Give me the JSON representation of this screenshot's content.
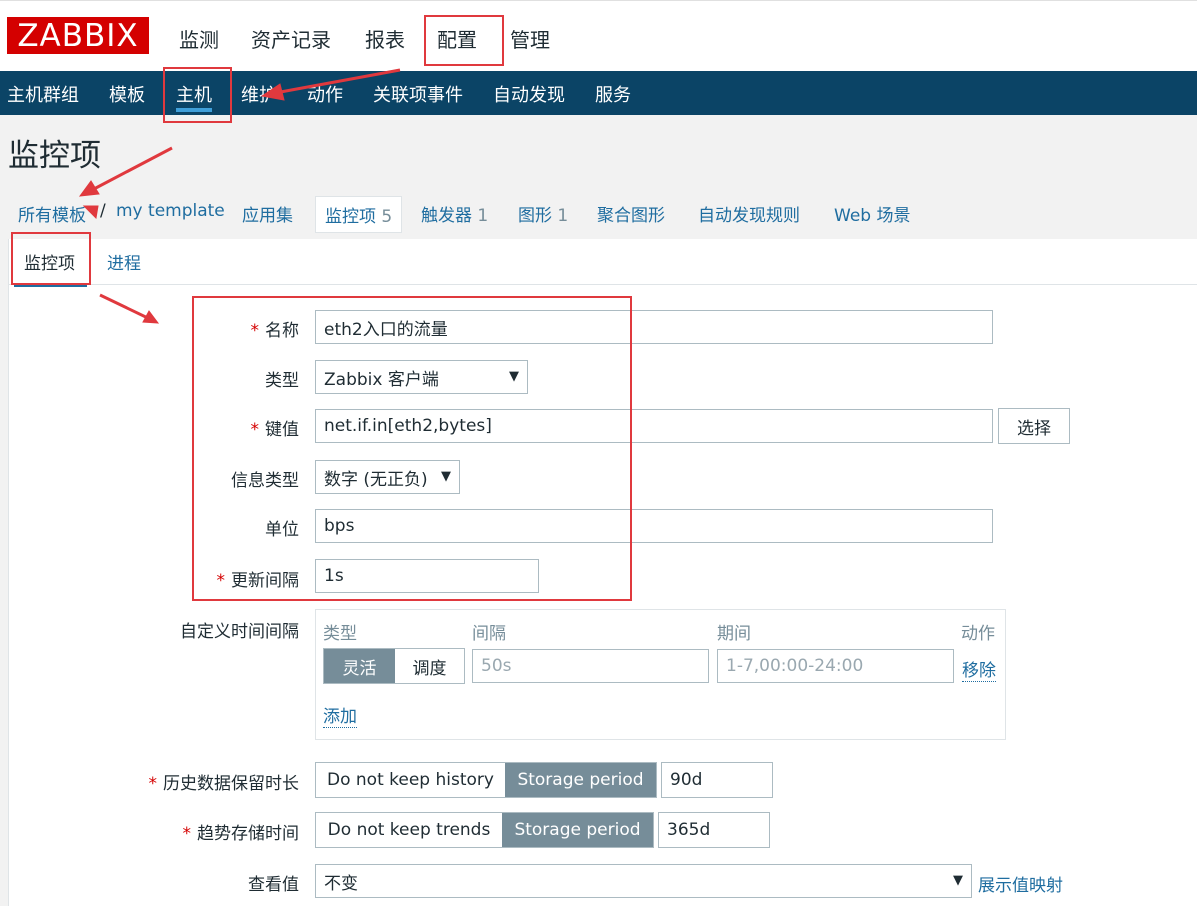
{
  "logo": "ZABBIX",
  "top_menu": [
    "监测",
    "资产记录",
    "报表",
    "配置",
    "管理"
  ],
  "sub_menu": [
    "主机群组",
    "模板",
    "主机",
    "维护",
    "动作",
    "关联项事件",
    "自动发现",
    "服务"
  ],
  "page_title": "监控项",
  "breadcrumb": {
    "all_templates": "所有模板",
    "separator": "/",
    "template": "my template",
    "applications": "应用集",
    "items": "监控项",
    "items_count": "5",
    "triggers": "触发器",
    "triggers_count": "1",
    "graphs": "图形",
    "graphs_count": "1",
    "screens": "聚合图形",
    "discovery": "自动发现规则",
    "web": "Web 场景"
  },
  "tabs": [
    "监控项",
    "进程"
  ],
  "form": {
    "name_label": "名称",
    "name_value": "eth2入口的流量",
    "type_label": "类型",
    "type_value": "Zabbix 客户端",
    "key_label": "键值",
    "key_value": "net.if.in[eth2,bytes]",
    "key_select": "选择",
    "info_type_label": "信息类型",
    "info_type_value": "数字 (无正负)",
    "units_label": "单位",
    "units_value": "bps",
    "interval_label": "更新间隔",
    "interval_value": "1s",
    "custom_label": "自定义时间间隔",
    "custom": {
      "col_type": "类型",
      "col_interval": "间隔",
      "col_period": "期间",
      "col_action": "动作",
      "flexible": "灵活",
      "scheduling": "调度",
      "interval_placeholder": "50s",
      "period_placeholder": "1-7,00:00-24:00",
      "remove": "移除",
      "add": "添加"
    },
    "history_label": "历史数据保留时长",
    "history_no": "Do not keep history",
    "history_storage": "Storage period",
    "history_value": "90d",
    "trends_label": "趋势存储时间",
    "trends_no": "Do not keep trends",
    "trends_storage": "Storage period",
    "trends_value": "365d",
    "valuemap_label": "查看值",
    "valuemap_value": "不变",
    "valuemap_link": "展示值映射"
  },
  "required_mark": "*",
  "dropdown_arrow": "▼",
  "colors": {
    "brand": "#d40000",
    "nav_bg": "#0b4466",
    "link": "#1f6da0",
    "annotation": "#e0393e"
  }
}
